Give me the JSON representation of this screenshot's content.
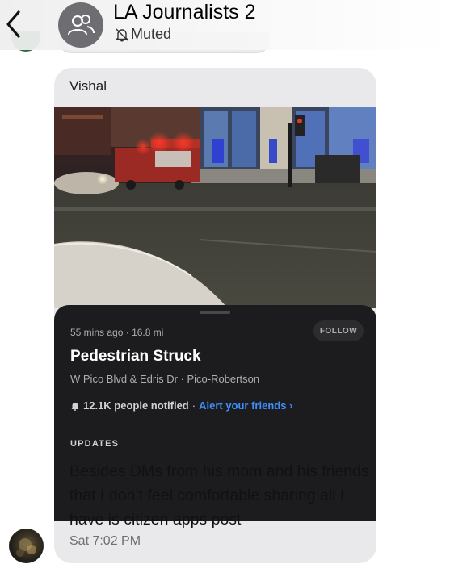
{
  "header": {
    "title": "LA Journalists 2",
    "status": "Muted",
    "back_icon": "chevron-left-icon",
    "avatar_icon": "group-people-icon",
    "muted_icon": "bell-slash-icon"
  },
  "message": {
    "sender": "Vishal",
    "text": "Besides DMs from his mom and his friends that I don’t feel comfortable sharing all I have is citizen apps post",
    "timestamp": "Sat 7:02 PM"
  },
  "incident_card": {
    "time": "55 mins ago",
    "distance": "16.8 mi",
    "follow_label": "FOLLOW",
    "title": "Pedestrian Struck",
    "location": "W Pico Blvd & Edris Dr · Pico-Robertson",
    "notified": "12.1K people notified",
    "separator": "·",
    "alert_link": "Alert your friends ›",
    "updates_label": "UPDATES",
    "bell_icon": "bell-icon"
  },
  "colors": {
    "bubble_bg": "#e9e9eb",
    "card_bg": "#1c1c1e",
    "link_blue": "#3d8ef7",
    "avatar_gray": "#6d6d72"
  }
}
